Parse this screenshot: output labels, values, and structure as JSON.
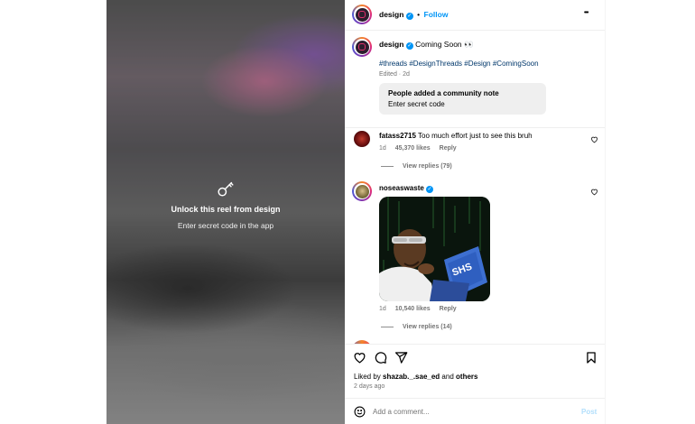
{
  "media": {
    "unlock_title": "Unlock this reel from design",
    "unlock_subtitle": "Enter secret code in the app"
  },
  "header": {
    "username": "design",
    "dot": "•",
    "follow_label": "Follow",
    "more_label": "•••"
  },
  "caption": {
    "username": "design",
    "text": "Coming Soon 👀",
    "hashtags": "#threads #DesignThreads #Design #ComingSoon",
    "meta": "Edited · 2d",
    "note_title": "People added a community note",
    "note_text": "Enter secret code"
  },
  "comments": [
    {
      "username": "fatass2715",
      "text": "Too much effort just to see this bruh",
      "time": "1d",
      "likes": "45,370 likes",
      "reply_label": "Reply",
      "view_replies": "View replies (79)"
    },
    {
      "username": "noseaswaste",
      "time": "1d",
      "likes": "10,540 likes",
      "reply_label": "Reply",
      "view_replies": "View replies (14)",
      "gif_text": "SHS"
    }
  ],
  "footer": {
    "liked_by_prefix": "Liked by",
    "liked_by_user": "shazab._.sae_ed",
    "liked_by_and": "and",
    "liked_by_others": "others",
    "time_ago": "2 days ago",
    "comment_placeholder": "Add a comment...",
    "post_label": "Post"
  },
  "colors": {
    "accent": "#0095f6",
    "hashtag": "#00376b",
    "muted": "#737373"
  }
}
